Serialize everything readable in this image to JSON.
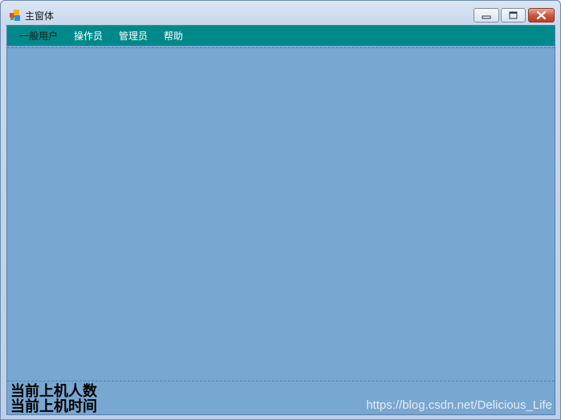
{
  "window": {
    "title": "主窗体",
    "icon": "app-windows-icon"
  },
  "controls": {
    "minimize": "minimize-icon",
    "maximize": "maximize-icon",
    "close": "close-icon"
  },
  "menubar": {
    "items": [
      {
        "label": "一般用户"
      },
      {
        "label": "操作员"
      },
      {
        "label": "管理员"
      },
      {
        "label": "帮助"
      }
    ]
  },
  "status": {
    "online_count_label": "当前上机人数",
    "online_time_label": "当前上机时间"
  },
  "watermark": "https://blog.csdn.net/Delicious_Life",
  "colors": {
    "menubar": "#00898a",
    "client": "#78a7d1",
    "titlebar": "#c9d8ec"
  }
}
